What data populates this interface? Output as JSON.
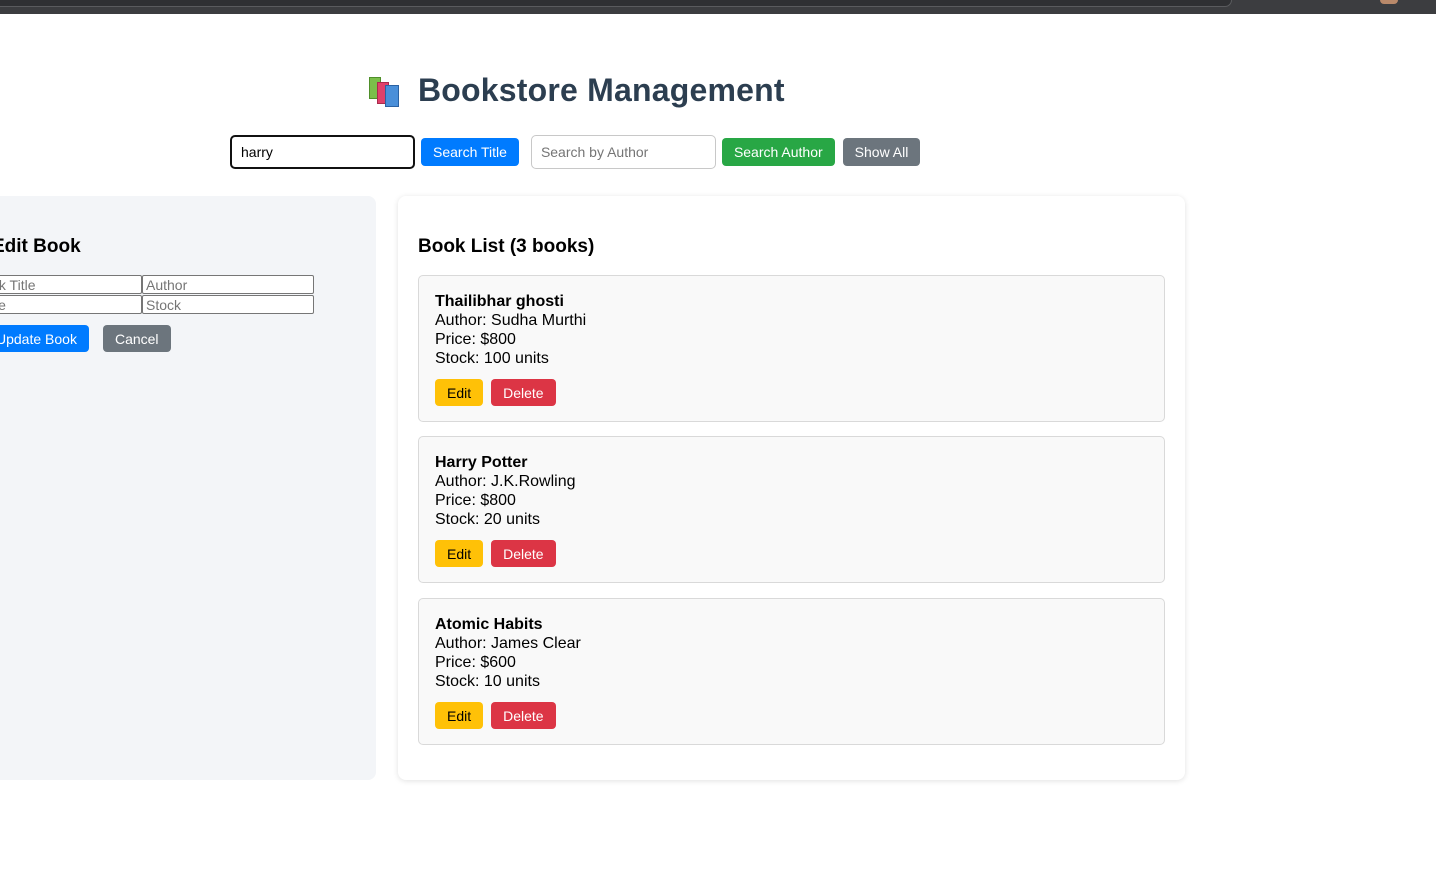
{
  "header": {
    "title": "Bookstore Management",
    "icon": "books-icon"
  },
  "search": {
    "title_value": "harry",
    "title_button": "Search Title",
    "author_placeholder": "Search by Author",
    "author_button": "Search Author",
    "show_all_button": "Show All"
  },
  "edit_form": {
    "heading": "Edit Book",
    "title_placeholder": "Book Title",
    "author_placeholder": "Author",
    "price_placeholder": "Price",
    "stock_placeholder": "Stock",
    "update_button": "Update Book",
    "cancel_button": "Cancel"
  },
  "book_list": {
    "heading": "Book List (3 books)",
    "books": [
      {
        "title": "Thailibhar ghosti",
        "author": "Author: Sudha Murthi",
        "price": "Price: $800",
        "stock": "Stock: 100 units",
        "edit": "Edit",
        "delete": "Delete"
      },
      {
        "title": "Harry Potter",
        "author": "Author: J.K.Rowling",
        "price": "Price: $800",
        "stock": "Stock: 20 units",
        "edit": "Edit",
        "delete": "Delete"
      },
      {
        "title": "Atomic Habits",
        "author": "Author: James Clear",
        "price": "Price: $600",
        "stock": "Stock: 10 units",
        "edit": "Edit",
        "delete": "Delete"
      }
    ]
  },
  "colors": {
    "primary": "#007bff",
    "success": "#28a745",
    "secondary": "#6c757d",
    "warning": "#ffc107",
    "danger": "#dc3545",
    "title": "#2c3e50"
  }
}
